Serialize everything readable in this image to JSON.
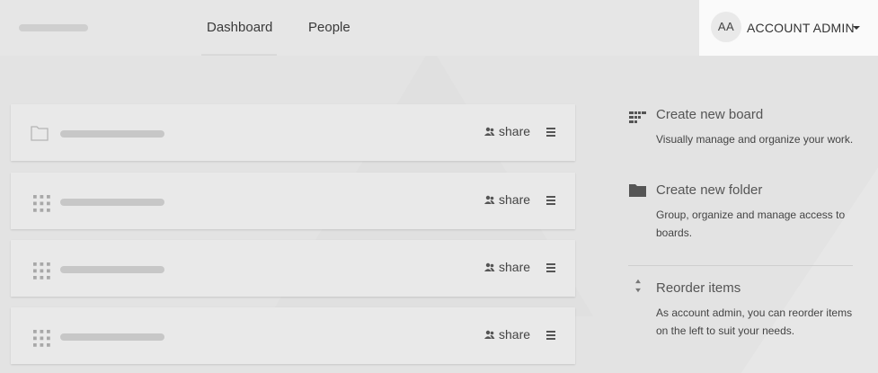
{
  "nav": {
    "dashboard": "Dashboard",
    "people": "People"
  },
  "account": {
    "initials": "AA",
    "name": "ACCOUNT ADMIN"
  },
  "boards": [
    {
      "type": "folder",
      "share_label": "share",
      "icon": "folder-icon"
    },
    {
      "type": "board",
      "share_label": "share",
      "icon": "board-grid-icon"
    },
    {
      "type": "board",
      "share_label": "share",
      "icon": "board-grid-icon"
    },
    {
      "type": "board",
      "share_label": "share",
      "icon": "board-grid-icon"
    }
  ],
  "side": {
    "create_board": {
      "title": "Create new board",
      "desc": "Visually manage and organize your work.",
      "icon": "board-icon"
    },
    "create_folder": {
      "title": "Create new folder",
      "desc": "Group, organize and manage access to boards.",
      "icon": "folder-icon"
    },
    "reorder": {
      "title": "Reorder items",
      "desc": "As account admin, you can reorder items on the left to suit your needs.",
      "icon": "reorder-icon"
    }
  },
  "colors": {
    "background": "#e3e3e3",
    "card": "#e9e9e9",
    "placeholder": "#c7c7c7",
    "account_bg": "#fafafa"
  }
}
